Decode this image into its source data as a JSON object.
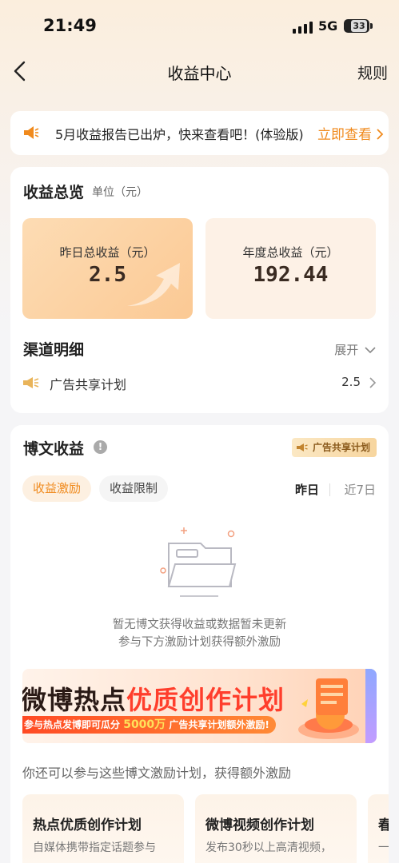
{
  "status": {
    "time": "21:49",
    "network": "5G",
    "battery": "33"
  },
  "nav": {
    "title": "收益中心",
    "rules": "规则"
  },
  "notice": {
    "text": "5月收益报告已出炉，快来查看吧！(体验版)",
    "link": "立即查看"
  },
  "overview": {
    "title": "收益总览",
    "unit": "单位（元）",
    "yesterday_label": "昨日总收益（元）",
    "yesterday_value": "2.5",
    "annual_label": "年度总收益（元）",
    "annual_value": "192.44"
  },
  "channels": {
    "title": "渠道明细",
    "expand": "展开",
    "items": [
      {
        "name": "广告共享计划",
        "value": "2.5"
      }
    ]
  },
  "post_income": {
    "title": "博文收益",
    "badge": "广告共享计划",
    "tabs": [
      "收益激励",
      "收益限制"
    ],
    "ranges": [
      "昨日",
      "近7日"
    ],
    "empty_line1": "暂无博文获得收益或数据暂未更新",
    "empty_line2": "参与下方激励计划获得额外激励",
    "banner": {
      "title_a": "微博热点",
      "title_b": "优质创作计划",
      "sub_a": "参与热点发博即可瓜分",
      "sub_amount": "5000万",
      "sub_b": "广告共享计划额外激励!"
    },
    "more_desc": "你还可以参与这些博文激励计划，获得额外激励",
    "plans": [
      {
        "title": "热点优质创作计划",
        "desc": "自媒体携带指定话题参与"
      },
      {
        "title": "微博视频创作计划",
        "desc": "发布30秒以上高清视频，"
      },
      {
        "title": "春",
        "desc": "一"
      }
    ]
  },
  "colors": {
    "accent": "#f08a1d",
    "banner_red": "#ff3e2c"
  }
}
